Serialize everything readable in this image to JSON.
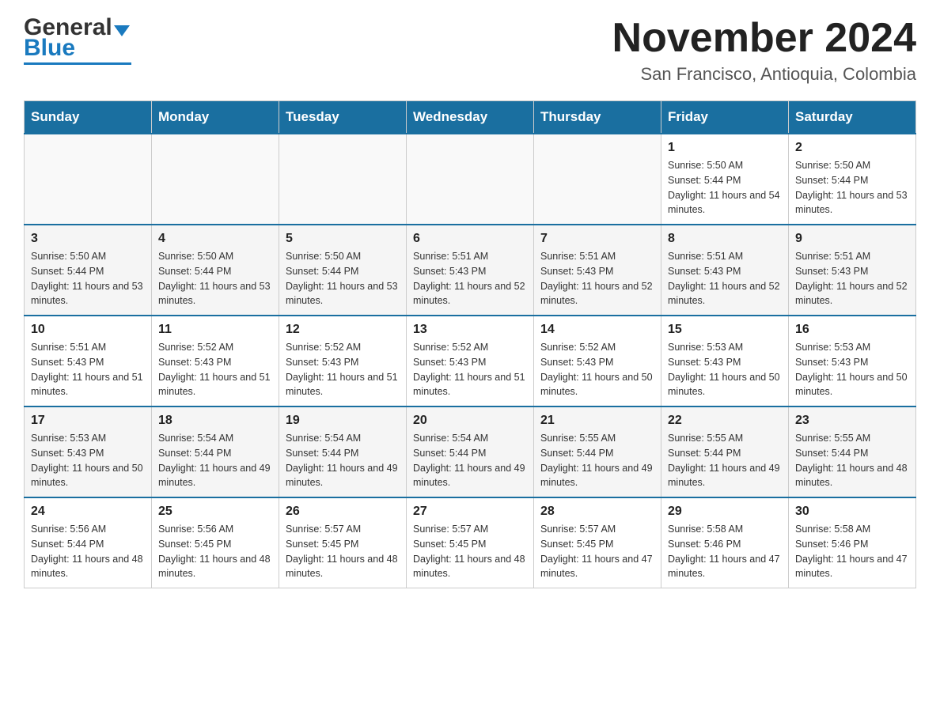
{
  "header": {
    "logo_general": "General",
    "logo_blue": "Blue",
    "month_title": "November 2024",
    "location": "San Francisco, Antioquia, Colombia"
  },
  "days_of_week": [
    "Sunday",
    "Monday",
    "Tuesday",
    "Wednesday",
    "Thursday",
    "Friday",
    "Saturday"
  ],
  "weeks": [
    {
      "days": [
        {
          "number": "",
          "sunrise": "",
          "sunset": "",
          "daylight": ""
        },
        {
          "number": "",
          "sunrise": "",
          "sunset": "",
          "daylight": ""
        },
        {
          "number": "",
          "sunrise": "",
          "sunset": "",
          "daylight": ""
        },
        {
          "number": "",
          "sunrise": "",
          "sunset": "",
          "daylight": ""
        },
        {
          "number": "",
          "sunrise": "",
          "sunset": "",
          "daylight": ""
        },
        {
          "number": "1",
          "sunrise": "Sunrise: 5:50 AM",
          "sunset": "Sunset: 5:44 PM",
          "daylight": "Daylight: 11 hours and 54 minutes."
        },
        {
          "number": "2",
          "sunrise": "Sunrise: 5:50 AM",
          "sunset": "Sunset: 5:44 PM",
          "daylight": "Daylight: 11 hours and 53 minutes."
        }
      ]
    },
    {
      "days": [
        {
          "number": "3",
          "sunrise": "Sunrise: 5:50 AM",
          "sunset": "Sunset: 5:44 PM",
          "daylight": "Daylight: 11 hours and 53 minutes."
        },
        {
          "number": "4",
          "sunrise": "Sunrise: 5:50 AM",
          "sunset": "Sunset: 5:44 PM",
          "daylight": "Daylight: 11 hours and 53 minutes."
        },
        {
          "number": "5",
          "sunrise": "Sunrise: 5:50 AM",
          "sunset": "Sunset: 5:44 PM",
          "daylight": "Daylight: 11 hours and 53 minutes."
        },
        {
          "number": "6",
          "sunrise": "Sunrise: 5:51 AM",
          "sunset": "Sunset: 5:43 PM",
          "daylight": "Daylight: 11 hours and 52 minutes."
        },
        {
          "number": "7",
          "sunrise": "Sunrise: 5:51 AM",
          "sunset": "Sunset: 5:43 PM",
          "daylight": "Daylight: 11 hours and 52 minutes."
        },
        {
          "number": "8",
          "sunrise": "Sunrise: 5:51 AM",
          "sunset": "Sunset: 5:43 PM",
          "daylight": "Daylight: 11 hours and 52 minutes."
        },
        {
          "number": "9",
          "sunrise": "Sunrise: 5:51 AM",
          "sunset": "Sunset: 5:43 PM",
          "daylight": "Daylight: 11 hours and 52 minutes."
        }
      ]
    },
    {
      "days": [
        {
          "number": "10",
          "sunrise": "Sunrise: 5:51 AM",
          "sunset": "Sunset: 5:43 PM",
          "daylight": "Daylight: 11 hours and 51 minutes."
        },
        {
          "number": "11",
          "sunrise": "Sunrise: 5:52 AM",
          "sunset": "Sunset: 5:43 PM",
          "daylight": "Daylight: 11 hours and 51 minutes."
        },
        {
          "number": "12",
          "sunrise": "Sunrise: 5:52 AM",
          "sunset": "Sunset: 5:43 PM",
          "daylight": "Daylight: 11 hours and 51 minutes."
        },
        {
          "number": "13",
          "sunrise": "Sunrise: 5:52 AM",
          "sunset": "Sunset: 5:43 PM",
          "daylight": "Daylight: 11 hours and 51 minutes."
        },
        {
          "number": "14",
          "sunrise": "Sunrise: 5:52 AM",
          "sunset": "Sunset: 5:43 PM",
          "daylight": "Daylight: 11 hours and 50 minutes."
        },
        {
          "number": "15",
          "sunrise": "Sunrise: 5:53 AM",
          "sunset": "Sunset: 5:43 PM",
          "daylight": "Daylight: 11 hours and 50 minutes."
        },
        {
          "number": "16",
          "sunrise": "Sunrise: 5:53 AM",
          "sunset": "Sunset: 5:43 PM",
          "daylight": "Daylight: 11 hours and 50 minutes."
        }
      ]
    },
    {
      "days": [
        {
          "number": "17",
          "sunrise": "Sunrise: 5:53 AM",
          "sunset": "Sunset: 5:43 PM",
          "daylight": "Daylight: 11 hours and 50 minutes."
        },
        {
          "number": "18",
          "sunrise": "Sunrise: 5:54 AM",
          "sunset": "Sunset: 5:44 PM",
          "daylight": "Daylight: 11 hours and 49 minutes."
        },
        {
          "number": "19",
          "sunrise": "Sunrise: 5:54 AM",
          "sunset": "Sunset: 5:44 PM",
          "daylight": "Daylight: 11 hours and 49 minutes."
        },
        {
          "number": "20",
          "sunrise": "Sunrise: 5:54 AM",
          "sunset": "Sunset: 5:44 PM",
          "daylight": "Daylight: 11 hours and 49 minutes."
        },
        {
          "number": "21",
          "sunrise": "Sunrise: 5:55 AM",
          "sunset": "Sunset: 5:44 PM",
          "daylight": "Daylight: 11 hours and 49 minutes."
        },
        {
          "number": "22",
          "sunrise": "Sunrise: 5:55 AM",
          "sunset": "Sunset: 5:44 PM",
          "daylight": "Daylight: 11 hours and 49 minutes."
        },
        {
          "number": "23",
          "sunrise": "Sunrise: 5:55 AM",
          "sunset": "Sunset: 5:44 PM",
          "daylight": "Daylight: 11 hours and 48 minutes."
        }
      ]
    },
    {
      "days": [
        {
          "number": "24",
          "sunrise": "Sunrise: 5:56 AM",
          "sunset": "Sunset: 5:44 PM",
          "daylight": "Daylight: 11 hours and 48 minutes."
        },
        {
          "number": "25",
          "sunrise": "Sunrise: 5:56 AM",
          "sunset": "Sunset: 5:45 PM",
          "daylight": "Daylight: 11 hours and 48 minutes."
        },
        {
          "number": "26",
          "sunrise": "Sunrise: 5:57 AM",
          "sunset": "Sunset: 5:45 PM",
          "daylight": "Daylight: 11 hours and 48 minutes."
        },
        {
          "number": "27",
          "sunrise": "Sunrise: 5:57 AM",
          "sunset": "Sunset: 5:45 PM",
          "daylight": "Daylight: 11 hours and 48 minutes."
        },
        {
          "number": "28",
          "sunrise": "Sunrise: 5:57 AM",
          "sunset": "Sunset: 5:45 PM",
          "daylight": "Daylight: 11 hours and 47 minutes."
        },
        {
          "number": "29",
          "sunrise": "Sunrise: 5:58 AM",
          "sunset": "Sunset: 5:46 PM",
          "daylight": "Daylight: 11 hours and 47 minutes."
        },
        {
          "number": "30",
          "sunrise": "Sunrise: 5:58 AM",
          "sunset": "Sunset: 5:46 PM",
          "daylight": "Daylight: 11 hours and 47 minutes."
        }
      ]
    }
  ]
}
